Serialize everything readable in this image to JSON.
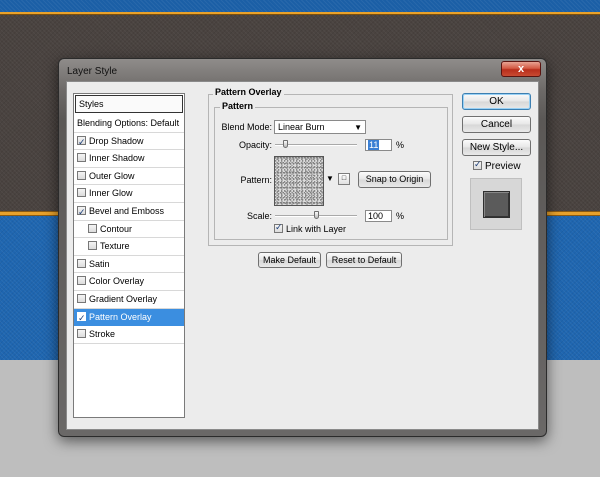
{
  "window": {
    "title": "Layer Style",
    "close_glyph": "x"
  },
  "list": {
    "header": "Styles",
    "items": [
      {
        "label": "Blending Options: Default",
        "type": "header"
      },
      {
        "label": "Drop Shadow",
        "checked": true
      },
      {
        "label": "Inner Shadow",
        "checked": false
      },
      {
        "label": "Outer Glow",
        "checked": false
      },
      {
        "label": "Inner Glow",
        "checked": false
      },
      {
        "label": "Bevel and Emboss",
        "checked": true
      },
      {
        "label": "Contour",
        "checked": false,
        "sub": true
      },
      {
        "label": "Texture",
        "checked": false,
        "sub": true
      },
      {
        "label": "Satin",
        "checked": false
      },
      {
        "label": "Color Overlay",
        "checked": false
      },
      {
        "label": "Gradient Overlay",
        "checked": false
      },
      {
        "label": "Pattern Overlay",
        "checked": true,
        "selected": true
      },
      {
        "label": "Stroke",
        "checked": false
      }
    ]
  },
  "panel": {
    "outer_title": "Pattern Overlay",
    "inner_title": "Pattern",
    "blend_mode_label": "Blend Mode:",
    "blend_mode_value": "Linear Burn",
    "opacity_label": "Opacity:",
    "opacity_value": "11",
    "opacity_percent": 11,
    "pattern_label": "Pattern:",
    "snap_button": "Snap to Origin",
    "scale_label": "Scale:",
    "scale_value": "100",
    "scale_percent": 100,
    "percent_sign": "%",
    "link_label": "Link with Layer",
    "link_checked": true,
    "make_default": "Make Default",
    "reset_default": "Reset to Default"
  },
  "buttons": {
    "ok": "OK",
    "cancel": "Cancel",
    "new_style": "New Style...",
    "preview_label": "Preview",
    "preview_checked": true
  },
  "icons": {
    "close": "close-icon",
    "dropdown": "chevron-down-icon",
    "pattern_menu": "triangle-right-icon",
    "new_preset": "new-preset-icon"
  }
}
